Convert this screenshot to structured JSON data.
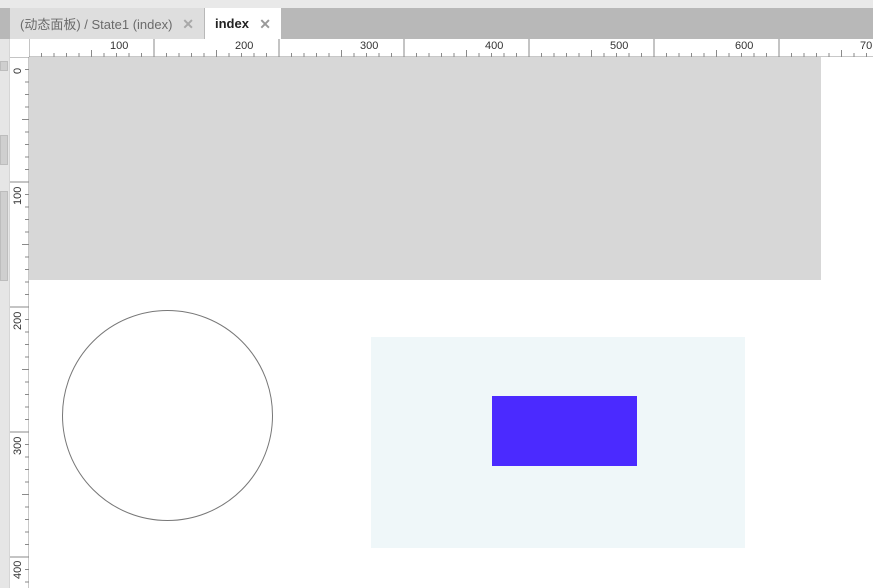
{
  "tabs": [
    {
      "label": "(动态面板) / State1 (index)",
      "active": false
    },
    {
      "label": "index",
      "active": true
    }
  ],
  "tab_close_glyph": "✕",
  "ruler": {
    "horizontal_labels": [
      "100",
      "200",
      "300",
      "400",
      "500",
      "600",
      "70"
    ],
    "vertical_labels": [
      "0",
      "100",
      "200",
      "300",
      "400"
    ]
  },
  "colors": {
    "gray_panel": "#d7d7d7",
    "light_panel": "#eff7f9",
    "blue_rect": "#4b2aff",
    "circle_stroke": "#777777"
  },
  "icons": {
    "tab_close": "close-icon"
  }
}
